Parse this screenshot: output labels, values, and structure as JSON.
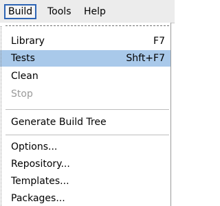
{
  "menubar": {
    "items": [
      {
        "label": "Build",
        "mnemonic": "B",
        "active": true
      },
      {
        "label": "Tools",
        "mnemonic": "T",
        "active": false
      },
      {
        "label": "Help",
        "mnemonic": "H",
        "active": false
      }
    ]
  },
  "dropdown": {
    "items": [
      {
        "label": "Library",
        "shortcut": "F7",
        "enabled": true,
        "highlighted": false
      },
      {
        "label": "Tests",
        "shortcut": "Shft+F7",
        "enabled": true,
        "highlighted": true
      },
      {
        "label": "Clean",
        "shortcut": "",
        "enabled": true,
        "highlighted": false
      },
      {
        "label": "Stop",
        "shortcut": "",
        "enabled": false,
        "highlighted": false
      },
      {
        "label": "Generate Build Tree",
        "shortcut": "",
        "enabled": true,
        "highlighted": false
      },
      {
        "label": "Options...",
        "shortcut": "",
        "enabled": true,
        "highlighted": false
      },
      {
        "label": "Repository...",
        "shortcut": "",
        "enabled": true,
        "highlighted": false
      },
      {
        "label": "Templates...",
        "shortcut": "",
        "enabled": true,
        "highlighted": false
      },
      {
        "label": "Packages...",
        "shortcut": "",
        "enabled": true,
        "highlighted": false
      }
    ]
  },
  "colors": {
    "menu_highlight": "#a9c9ea",
    "active_menu_border": "#2d64b4",
    "disabled_text": "#9a9a9a"
  }
}
